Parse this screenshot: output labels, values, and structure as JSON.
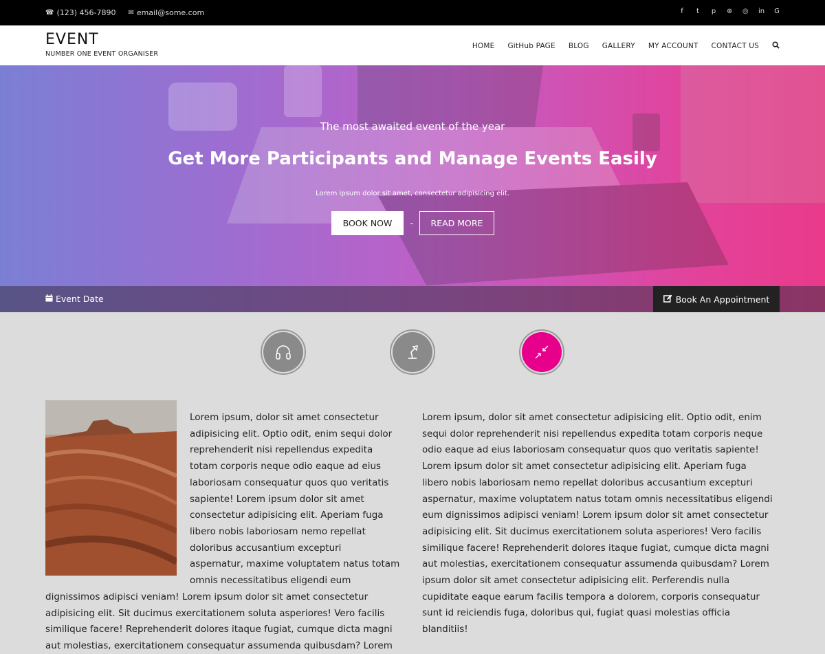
{
  "topbar": {
    "phone": "(123) 456-7890",
    "email": "email@some.com",
    "social": [
      "facebook-icon",
      "twitter-icon",
      "pinterest-icon",
      "dribbble-icon",
      "instagram-icon",
      "linkedin-icon",
      "google-plus-icon"
    ]
  },
  "header": {
    "logo_title": "EVENT",
    "logo_subtitle": "NUMBER ONE EVENT ORGANISER",
    "nav": [
      "HOME",
      "GitHub PAGE",
      "BLOG",
      "GALLERY",
      "MY ACCOUNT",
      "CONTACT US"
    ]
  },
  "hero": {
    "eyebrow": "The most awaited event of the year",
    "headline": "Get More Participants and Manage Events Easily",
    "tagline": "Lorem ipsum dolor sit amet, consectetur adipisicing elit.",
    "book_now": "BOOK NOW",
    "read_more": "READ MORE",
    "event_date": "Event Date",
    "appointment": "Book An Appointment"
  },
  "features": [
    "headphones-icon",
    "desk-lamp-icon",
    "compress-arrows-icon"
  ],
  "colors": {
    "accent": "#e6008c",
    "topbar": "#000000",
    "appointment_bg": "#222222"
  },
  "content": {
    "col1_lines_right": [
      "Lorem ipsum, dolor sit amet consectetur",
      "adipisicing elit. Optio odit, enim sequi dolor",
      "reprehenderit nisi repellendus expedita",
      "totam corporis neque odio eaque ad eius",
      "laboriosam consequatur quos quo veritatis",
      "sapiente! Lorem ipsum dolor sit amet",
      "consectetur adipisicing elit. Aperiam fuga",
      "libero nobis laboriosam nemo repellat",
      "doloribus accusantium excepturi",
      "aspernatur, maxime voluptatem natus totam",
      "omnis necessitatibus eligendi eum"
    ],
    "col1_lines_below": [
      "dignissimos adipisci veniam! Lorem ipsum dolor sit amet consectetur",
      "adipisicing elit. Sit ducimus exercitationem soluta asperiores! Vero facilis",
      "similique facere! Reprehenderit dolores itaque fugiat, cumque dicta magni",
      "aut molestias, exercitationem consequatur assumenda quibusdam? Lorem"
    ],
    "col2_lines": [
      "Lorem ipsum, dolor sit amet consectetur adipisicing elit. Optio odit, enim",
      "sequi dolor reprehenderit nisi repellendus expedita totam corporis neque",
      "odio eaque ad eius laboriosam consequatur quos quo veritatis sapiente!",
      "Lorem ipsum dolor sit amet consectetur adipisicing elit. Aperiam fuga",
      "libero nobis laboriosam nemo repellat doloribus accusantium excepturi",
      "aspernatur, maxime voluptatem natus totam omnis necessitatibus eligendi",
      "eum dignissimos adipisci veniam! Lorem ipsum dolor sit amet consectetur",
      "adipisicing elit. Sit ducimus exercitationem soluta asperiores! Vero facilis",
      "similique facere! Reprehenderit dolores itaque fugiat, cumque dicta magni",
      "aut molestias, exercitationem consequatur assumenda quibusdam? Lorem",
      "ipsum dolor sit amet consectetur adipisicing elit. Perferendis nulla",
      "cupiditate eaque earum facilis tempora a dolorem, corporis consequatur",
      "sunt id reiciendis fuga, doloribus qui, fugiat quasi molestias officia",
      "blanditiis!"
    ]
  }
}
